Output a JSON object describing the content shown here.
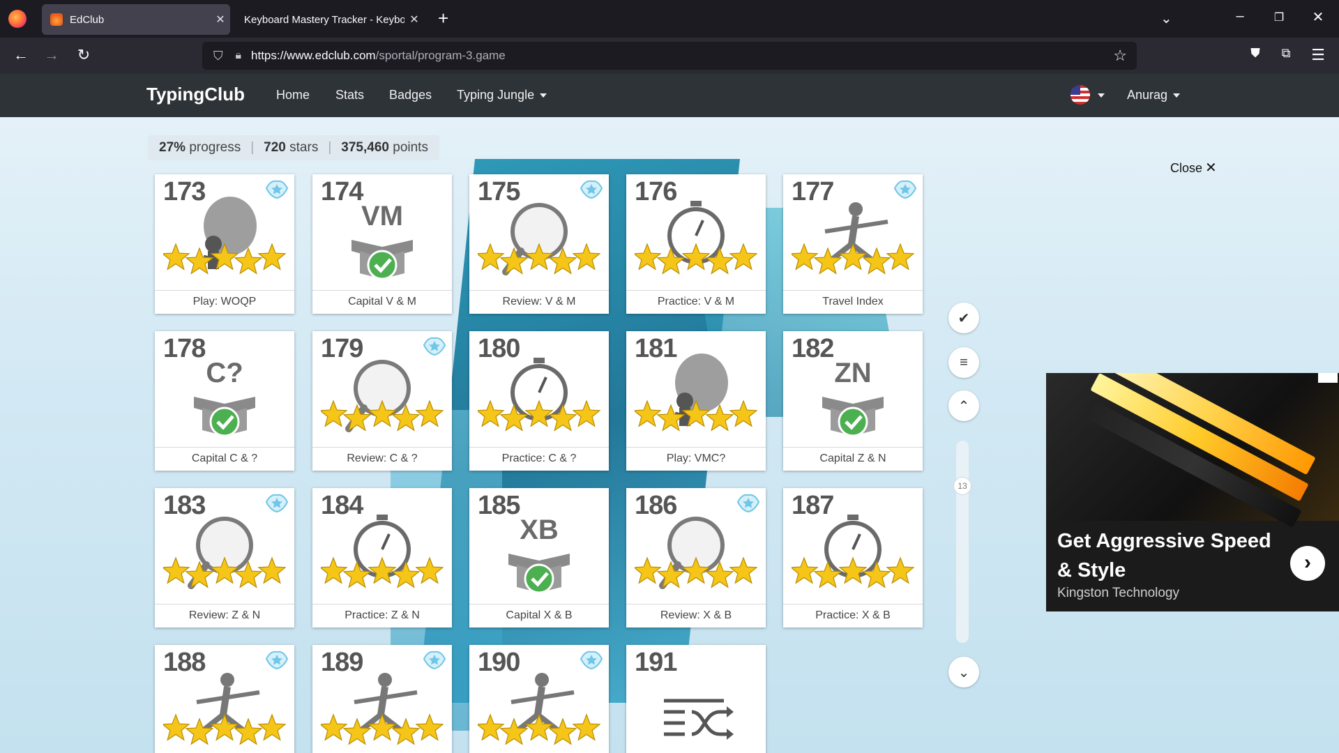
{
  "browser": {
    "tabs": [
      {
        "title": "EdClub",
        "active": true
      },
      {
        "title": "Keyboard Mastery Tracker - Keyboa",
        "active": false
      }
    ],
    "url_host": "https://www.edclub.com",
    "url_path": "/sportal/program-3.game"
  },
  "site": {
    "brand": "TypingClub",
    "menu": [
      "Home",
      "Stats",
      "Badges",
      "Typing Jungle"
    ],
    "user": "Anurag"
  },
  "stats": {
    "progress_value": "27%",
    "progress_label": "progress",
    "stars_value": "720",
    "stars_label": "stars",
    "points_value": "375,460",
    "points_label": "points"
  },
  "close_label": "Close",
  "scroll_position": "13",
  "lessons": [
    {
      "num": "173",
      "label": "Play: WOQP",
      "kind": "balloon",
      "badge": true
    },
    {
      "num": "174",
      "label": "Capital V & M",
      "kind": "box",
      "letters": "VM",
      "badge": false
    },
    {
      "num": "175",
      "label": "Review: V & M",
      "kind": "magnifier",
      "badge": true
    },
    {
      "num": "176",
      "label": "Practice: V & M",
      "kind": "stopwatch",
      "badge": false
    },
    {
      "num": "177",
      "label": "Travel Index",
      "kind": "runner",
      "badge": true
    },
    {
      "num": "178",
      "label": "Capital C & ?",
      "kind": "box",
      "letters": "C?",
      "badge": false
    },
    {
      "num": "179",
      "label": "Review: C & ?",
      "kind": "magnifier",
      "badge": true
    },
    {
      "num": "180",
      "label": "Practice: C & ?",
      "kind": "stopwatch",
      "badge": false
    },
    {
      "num": "181",
      "label": "Play: VMC?",
      "kind": "balloon",
      "badge": false
    },
    {
      "num": "182",
      "label": "Capital Z & N",
      "kind": "box",
      "letters": "ZN",
      "badge": false
    },
    {
      "num": "183",
      "label": "Review: Z & N",
      "kind": "magnifier",
      "badge": true
    },
    {
      "num": "184",
      "label": "Practice: Z & N",
      "kind": "stopwatch",
      "badge": false
    },
    {
      "num": "185",
      "label": "Capital X & B",
      "kind": "box",
      "letters": "XB",
      "badge": false
    },
    {
      "num": "186",
      "label": "Review: X & B",
      "kind": "magnifier",
      "badge": true
    },
    {
      "num": "187",
      "label": "Practice: X & B",
      "kind": "stopwatch",
      "badge": false
    },
    {
      "num": "188",
      "label": "",
      "kind": "runner",
      "badge": true
    },
    {
      "num": "189",
      "label": "",
      "kind": "runner",
      "badge": true
    },
    {
      "num": "190",
      "label": "",
      "kind": "runner",
      "badge": true
    },
    {
      "num": "191",
      "label": "",
      "kind": "shuffle",
      "badge": false
    }
  ],
  "ad": {
    "headline": "Get Aggressive Speed & Style",
    "advertiser": "Kingston Technology"
  },
  "colors": {
    "header_bg": "#2e3338",
    "star": "#f5c518",
    "check": "#4caf50",
    "badge": "#6fc6e8"
  }
}
